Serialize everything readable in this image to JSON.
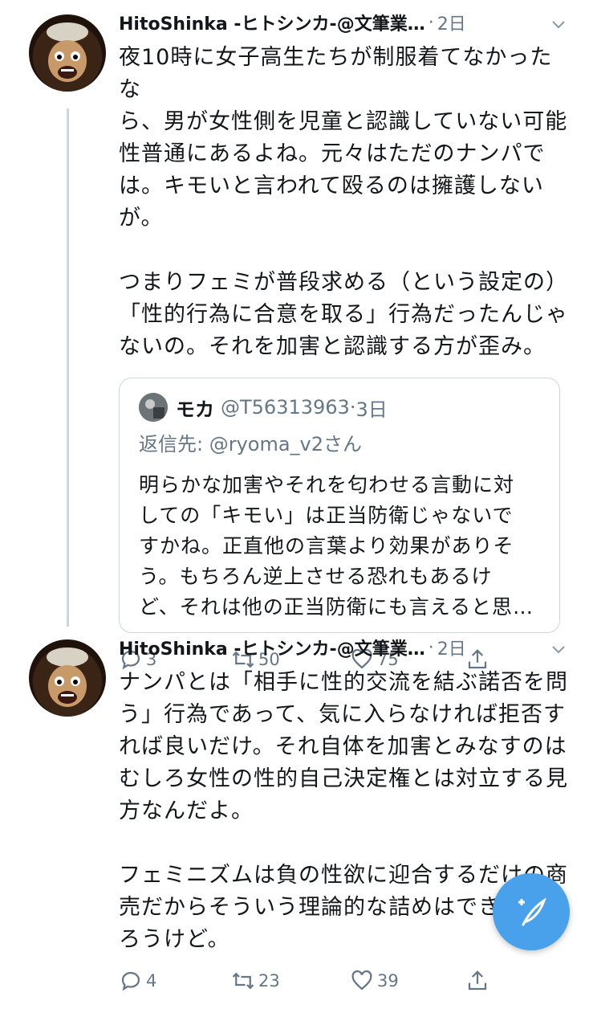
{
  "tweets": [
    {
      "author": "HitoShinka -ヒトシンカ-@文筆業…",
      "separator": "·",
      "time": "2日",
      "text_lines": [
        "夜10時に女子高生たちが制服着てなかったな",
        "ら、男が女性側を児童と認識していない可能",
        "性普通にあるよね。元々はただのナンパで",
        "は。キモいと言われて殴るのは擁護しない",
        "が。",
        "",
        "つまりフェミが普段求める（という設定の）",
        "「性的行為に合意を取る」行為だったんじゃ",
        "ないの。それを加害と認識する方が歪み。"
      ],
      "quote": {
        "name": "モカ",
        "handle": "@T56313963",
        "separator": "·",
        "time": "3日",
        "reply_to": "返信先: @ryoma_v2さん",
        "text_lines": [
          "明らかな加害やそれを匂わせる言動に対",
          "しての「キモい」は正当防衛じゃないで",
          "すかね。正直他の言葉より効果がありそ",
          "う。もちろん逆上させる恐れもあるけ",
          "ど、それは他の正当防衛にも言えると思…"
        ]
      },
      "replies": "3",
      "retweets": "50",
      "likes": "75"
    },
    {
      "author": "HitoShinka -ヒトシンカ-@文筆業…",
      "separator": "·",
      "time": "2日",
      "text_lines": [
        "ナンパとは「相手に性的交流を結ぶ諾否を問",
        "う」行為であって、気に入らなければ拒否す",
        "れば良いだけ。それ自体を加害とみなすのは",
        "むしろ女性の性的自己決定権とは対立する見",
        "方なんだよ。",
        "",
        "フェミニズムは負の性欲に迎合するだけの商",
        "売だからそういう理論的な詰めはできないだ",
        "ろうけど。"
      ],
      "replies": "4",
      "retweets": "23",
      "likes": "39"
    }
  ],
  "icons": {
    "reply": "speech-bubble",
    "retweet": "retweet-arrows",
    "like": "heart",
    "share": "share-upload",
    "caret": "chevron-down",
    "fab": "compose-feather-plus"
  },
  "colors": {
    "accent": "#4aa1eb",
    "muted": "#657786",
    "border": "#ccd6dd"
  }
}
